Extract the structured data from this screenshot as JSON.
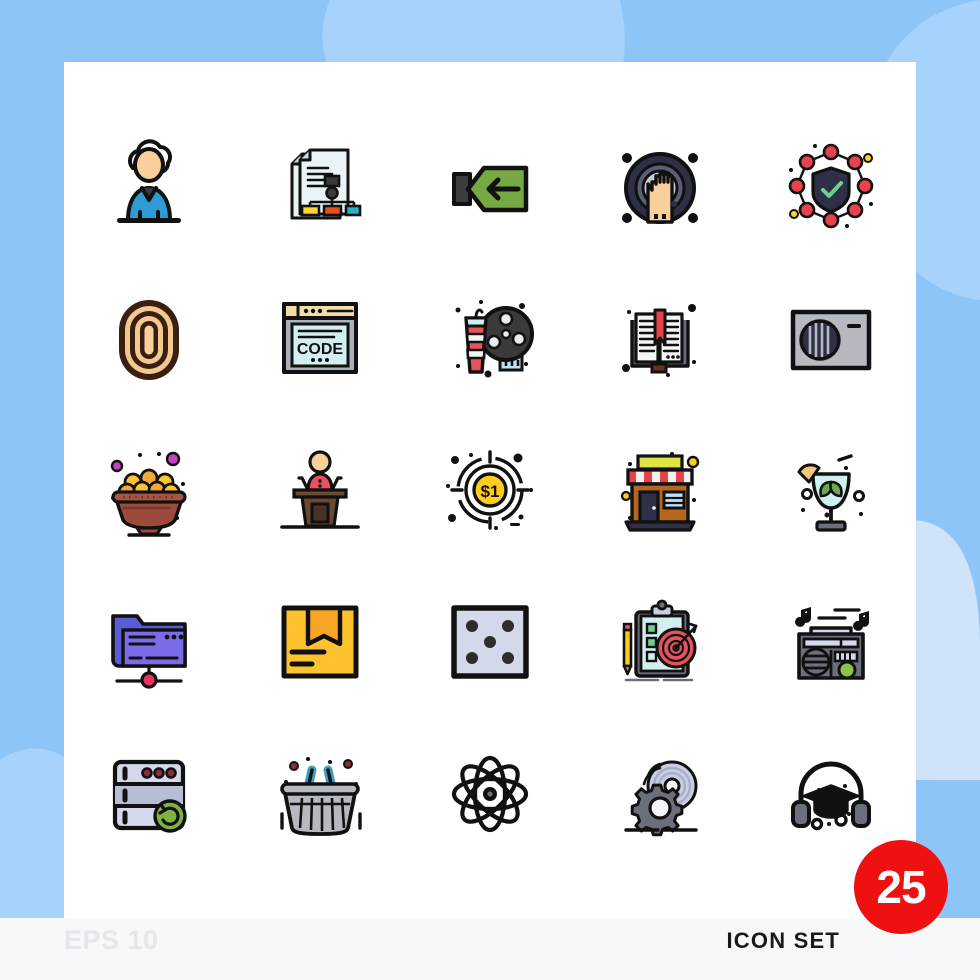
{
  "meta": {
    "format_label": "EPS 10",
    "set_label": "ICON SET",
    "count": "25",
    "badge_color": "#EF1111",
    "background_color": "#8EC5F8",
    "card_color": "#FFFFFF",
    "band_color": "#F6F8FA",
    "eps_text_color": "#E3E8ED"
  },
  "grid": {
    "columns": 5,
    "rows": 5,
    "total_icons": 25,
    "icons": [
      {
        "id": 1,
        "name": "person-idea-icon",
        "label": "Person with idea cloud",
        "colors": [
          "#2D9CD4",
          "#F9CF9C",
          "#3A3A3A",
          "#111111"
        ]
      },
      {
        "id": 2,
        "name": "document-flowchart-icon",
        "label": "Document flow chart",
        "colors": [
          "#DCEEF0",
          "#FFD42A",
          "#E2521B",
          "#2BB0C9",
          "#111111"
        ]
      },
      {
        "id": 3,
        "name": "back-arrow-flag-icon",
        "label": "Green back arrow flag",
        "colors": [
          "#76A843",
          "#3D3D3D",
          "#111111"
        ]
      },
      {
        "id": 4,
        "name": "hand-scan-icon",
        "label": "Hand palm scan",
        "colors": [
          "#2D3047",
          "#C9CBD6",
          "#F9CF9C",
          "#111111"
        ]
      },
      {
        "id": 5,
        "name": "network-security-icon",
        "label": "Network shield security",
        "colors": [
          "#E8424A",
          "#2D3047",
          "#6BD18B",
          "#FFD42A",
          "#111111"
        ]
      },
      {
        "id": 6,
        "name": "fingerprint-icon",
        "label": "Fingerprint",
        "colors": [
          "#F9CF9C",
          "#4A2A18",
          "#111111"
        ]
      },
      {
        "id": 7,
        "name": "code-browser-icon",
        "label": "Code browser window",
        "colors": [
          "#F2DCA8",
          "#D3EEF0",
          "#A8B0B8",
          "#111111"
        ]
      },
      {
        "id": 8,
        "name": "cinema-reel-icon",
        "label": "Cinema drink and reel",
        "colors": [
          "#3A3A3A",
          "#E8525C",
          "#D3EEF0",
          "#111111"
        ]
      },
      {
        "id": 9,
        "name": "open-book-icon",
        "label": "Open book with bookmark",
        "colors": [
          "#F2F2F2",
          "#E8424A",
          "#6A6F7B",
          "#4A2A18",
          "#111111"
        ]
      },
      {
        "id": 10,
        "name": "air-conditioner-icon",
        "label": "Air cooler unit",
        "colors": [
          "#B6BAC0",
          "#2D3047",
          "#111111"
        ]
      },
      {
        "id": 11,
        "name": "sweets-bowl-icon",
        "label": "Bowl of laddu sweets",
        "colors": [
          "#9C4A3C",
          "#FFC531",
          "#F2A93B",
          "#C840C0",
          "#111111"
        ]
      },
      {
        "id": 12,
        "name": "podium-speaker-icon",
        "label": "Speaker at podium",
        "colors": [
          "#E8525C",
          "#F9CF9C",
          "#6B4A33",
          "#4A3323",
          "#111111"
        ]
      },
      {
        "id": 13,
        "name": "dollar-target-icon",
        "label": "One dollar target",
        "colors": [
          "#FFCD1C",
          "#111111"
        ]
      },
      {
        "id": 14,
        "name": "storefront-icon",
        "label": "Shop storefront",
        "colors": [
          "#B5671F",
          "#E8424A",
          "#DCE441",
          "#BFE0F2",
          "#2D3047",
          "#111111"
        ]
      },
      {
        "id": 15,
        "name": "mojito-cocktail-icon",
        "label": "Mint cocktail glass",
        "colors": [
          "#CFF0EC",
          "#6CA84F",
          "#F2C879",
          "#6A6F7B",
          "#111111"
        ]
      },
      {
        "id": 16,
        "name": "shared-folder-icon",
        "label": "Shared network folder",
        "colors": [
          "#5B5BD6",
          "#7A6BE8",
          "#E8345E",
          "#111111"
        ]
      },
      {
        "id": 17,
        "name": "package-box-icon",
        "label": "Delivery package box",
        "colors": [
          "#FDC22D",
          "#F5A623",
          "#111111"
        ]
      },
      {
        "id": 18,
        "name": "dice-five-icon",
        "label": "Dice showing five",
        "colors": [
          "#D3D9EA",
          "#2D2D2D",
          "#111111"
        ]
      },
      {
        "id": 19,
        "name": "goal-clipboard-icon",
        "label": "Clipboard goal target",
        "colors": [
          "#D3EEF0",
          "#E8525C",
          "#6BD18B",
          "#FFCD1C",
          "#6A6F7B",
          "#111111"
        ]
      },
      {
        "id": 20,
        "name": "radio-boombox-icon",
        "label": "Radio boombox",
        "colors": [
          "#6A6F7B",
          "#D3D9EA",
          "#8BC34A",
          "#111111"
        ]
      },
      {
        "id": 21,
        "name": "server-restore-icon",
        "label": "Server restore backup",
        "colors": [
          "#D3D9EA",
          "#B6BDD4",
          "#7CB342",
          "#8C2B3A",
          "#111111"
        ]
      },
      {
        "id": 22,
        "name": "shopping-basket-icon",
        "label": "Shopping basket",
        "colors": [
          "#B6BAC0",
          "#3A9EC4",
          "#8C2B3A",
          "#111111"
        ]
      },
      {
        "id": 23,
        "name": "atom-science-icon",
        "label": "Atom science symbol",
        "colors": [
          "#111111",
          "#6A6F7B"
        ]
      },
      {
        "id": 24,
        "name": "gear-disc-icon",
        "label": "Gear and spinning disc",
        "colors": [
          "#6A6F7B",
          "#C9CEE4",
          "#111111"
        ]
      },
      {
        "id": 25,
        "name": "education-headphones-icon",
        "label": "Graduation cap headphones",
        "colors": [
          "#6A6F7B",
          "#111111"
        ]
      }
    ]
  }
}
